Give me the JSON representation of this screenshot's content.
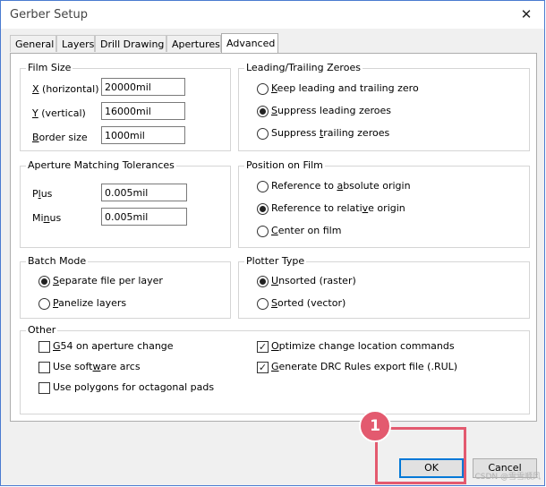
{
  "window": {
    "title": "Gerber Setup",
    "close_glyph": "✕"
  },
  "tabs": [
    {
      "label": "General"
    },
    {
      "label": "Layers"
    },
    {
      "label": "Drill Drawing"
    },
    {
      "label": "Apertures"
    },
    {
      "label": "Advanced",
      "active": true
    }
  ],
  "film_size": {
    "title": "Film Size",
    "x_label_key": "X",
    "x_label_rest": " (horizontal)",
    "x_value": "20000mil",
    "y_label_key": "Y",
    "y_label_rest": " (vertical)",
    "y_value": "16000mil",
    "border_label_key": "B",
    "border_label_rest": "order size",
    "border_value": "1000mil"
  },
  "zeroes": {
    "title": "Leading/Trailing Zeroes",
    "options": [
      {
        "pre": "",
        "key": "K",
        "post": "eep leading and trailing zero",
        "checked": false
      },
      {
        "pre": "",
        "key": "S",
        "post": "uppress leading zeroes",
        "checked": true
      },
      {
        "pre": "Suppress ",
        "key": "t",
        "post": "railing zeroes",
        "checked": false
      }
    ]
  },
  "aperture_matching": {
    "title": "Aperture Matching Tolerances",
    "plus_pre": "P",
    "plus_key": "l",
    "plus_post": "us",
    "plus_value": "0.005mil",
    "minus_pre": "Mi",
    "minus_key": "n",
    "minus_post": "us",
    "minus_value": "0.005mil"
  },
  "position": {
    "title": "Position on Film",
    "options": [
      {
        "pre": "Reference to ",
        "key": "a",
        "post": "bsolute origin",
        "checked": false
      },
      {
        "pre": "Reference to relati",
        "key": "v",
        "post": "e origin",
        "checked": true
      },
      {
        "pre": "",
        "key": "C",
        "post": "enter on film",
        "checked": false
      }
    ]
  },
  "batch_mode": {
    "title": "Batch Mode",
    "options": [
      {
        "pre": "",
        "key": "S",
        "post": "eparate file per layer",
        "checked": true
      },
      {
        "pre": "",
        "key": "P",
        "post": "anelize layers",
        "checked": false
      }
    ]
  },
  "plotter_type": {
    "title": "Plotter Type",
    "options": [
      {
        "pre": "",
        "key": "U",
        "post": "nsorted (raster)",
        "checked": true
      },
      {
        "pre": "",
        "key": "S",
        "post": "orted (vector)",
        "checked": false
      }
    ]
  },
  "other": {
    "title": "Other",
    "left": [
      {
        "pre": "",
        "key": "G",
        "post": "54 on aperture change",
        "checked": false
      },
      {
        "pre": "Use soft",
        "key": "w",
        "post": "are arcs",
        "checked": false
      },
      {
        "pre": "Use polygons for octagonal pads",
        "key": "",
        "post": "",
        "checked": false
      }
    ],
    "right": [
      {
        "pre": "",
        "key": "O",
        "post": "ptimize change location commands",
        "checked": true
      },
      {
        "pre": "",
        "key": "G",
        "post": "enerate DRC Rules export file (.RUL)",
        "checked": true
      }
    ]
  },
  "buttons": {
    "ok": "OK",
    "cancel": "Cancel"
  },
  "annotation": {
    "badge": "1",
    "color": "#e35a6f"
  },
  "watermark": "CSDN @雪雪顺风"
}
